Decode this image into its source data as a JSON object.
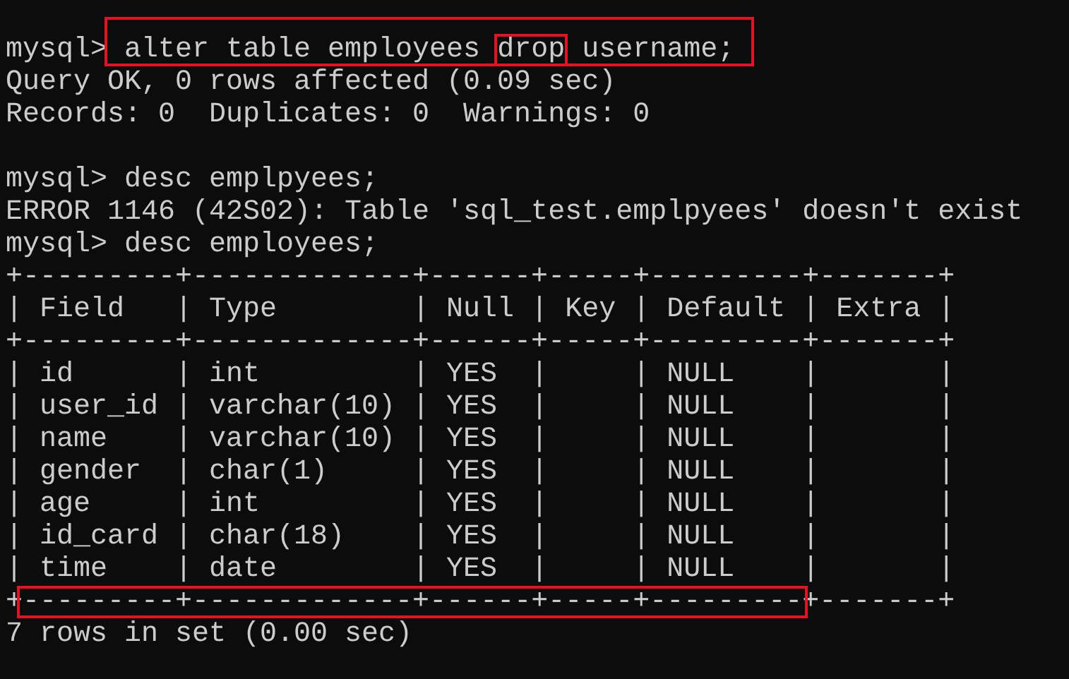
{
  "terminal": {
    "lines": [
      {
        "kind": "text",
        "segments": [
          {
            "text": "mysql> "
          },
          {
            "text": "alter table employees ",
            "in_box": true
          },
          {
            "text": "drop",
            "in_box": true,
            "boxed": true
          },
          {
            "text": " username;",
            "in_box": true
          }
        ]
      },
      {
        "kind": "text",
        "segments": [
          {
            "text": "Query OK, 0 rows affected (0.09 sec)"
          }
        ]
      },
      {
        "kind": "text",
        "segments": [
          {
            "text": "Records: 0  Duplicates: 0  Warnings: 0"
          }
        ]
      },
      {
        "kind": "blank"
      },
      {
        "kind": "text",
        "segments": [
          {
            "text": "mysql> desc emplpyees;"
          }
        ]
      },
      {
        "kind": "text",
        "segments": [
          {
            "text": "ERROR 1146 (42S02): Table 'sql_test.emplpyees' doesn't exist"
          }
        ]
      },
      {
        "kind": "text",
        "segments": [
          {
            "text": "mysql> desc employees;"
          }
        ]
      },
      {
        "kind": "text",
        "segments": [
          {
            "text": "+---------+-------------+------+-----+---------+-------+"
          }
        ]
      },
      {
        "kind": "text",
        "segments": [
          {
            "text": "| Field   | Type        | Null | Key | Default | Extra |"
          }
        ]
      },
      {
        "kind": "text",
        "segments": [
          {
            "text": "+---------+-------------+------+-----+---------+-------+"
          }
        ]
      },
      {
        "kind": "text",
        "segments": [
          {
            "text": "| id      | int         | YES  |     | NULL    |       |"
          }
        ]
      },
      {
        "kind": "text",
        "segments": [
          {
            "text": "| user_id | varchar(10) | YES  |     | NULL    |       |"
          }
        ]
      },
      {
        "kind": "text",
        "segments": [
          {
            "text": "| name    | varchar(10) | YES  |     | NULL    |       |"
          }
        ]
      },
      {
        "kind": "text",
        "segments": [
          {
            "text": "| gender  | char(1)     | YES  |     | NULL    |       |"
          }
        ]
      },
      {
        "kind": "text",
        "segments": [
          {
            "text": "| age     | int         | YES  |     | NULL    |       |"
          }
        ]
      },
      {
        "kind": "text",
        "segments": [
          {
            "text": "| id_card | char(18)    | YES  |     | NULL    |       |"
          }
        ]
      },
      {
        "kind": "text",
        "segments": [
          {
            "text": "| time    | date        | YES  |     | NULL    |       |"
          }
        ]
      },
      {
        "kind": "text",
        "segments": [
          {
            "text": "+"
          },
          {
            "text": "---------+-------------+------+-----+---------",
            "in_box": true
          },
          {
            "text": "+-------+"
          }
        ]
      },
      {
        "kind": "text",
        "segments": [
          {
            "text": "7 rows in set (0.00 sec)"
          }
        ]
      }
    ]
  }
}
